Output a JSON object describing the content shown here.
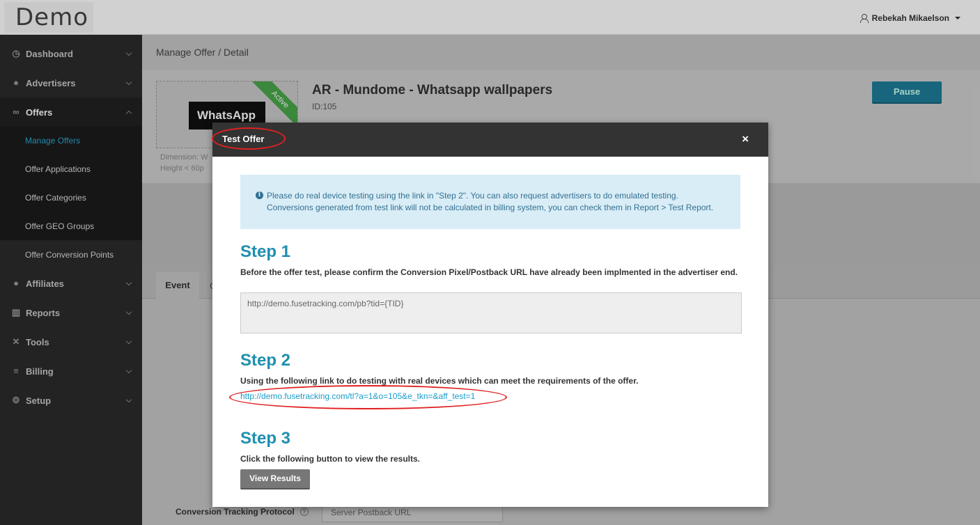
{
  "app": {
    "logo": "Demo",
    "user_name": "Rebekah Mikaelson"
  },
  "sidebar": {
    "items": [
      {
        "label": "Dashboard",
        "icon": "dashboard-icon"
      },
      {
        "label": "Advertisers",
        "icon": "user-icon"
      },
      {
        "label": "Offers",
        "icon": "link-icon"
      },
      {
        "label": "Affiliates",
        "icon": "users-icon"
      },
      {
        "label": "Reports",
        "icon": "bar-chart-icon"
      },
      {
        "label": "Tools",
        "icon": "tools-icon"
      },
      {
        "label": "Billing",
        "icon": "coins-icon"
      },
      {
        "label": "Setup",
        "icon": "gear-icon"
      }
    ],
    "offers_submenu": [
      "Manage Offers",
      "Offer Applications",
      "Offer Categories",
      "Offer GEO Groups",
      "Offer Conversion Points"
    ]
  },
  "main": {
    "breadcrumb": "Manage Offer / Detail",
    "offer_title": "AR - Mundome - Whatsapp wallpapers",
    "offer_id": "ID:105",
    "status_ribbon": "Active",
    "thumb_text": "WhatsApp",
    "thumb_note_1": "Dimension: W",
    "thumb_note_2": "Height < 60p",
    "pause_label": "Pause",
    "tab_event": "Event",
    "tab_other": "C",
    "conversion_label": "Conversion Tracking Protocol",
    "conversion_value": "Server Postback URL"
  },
  "modal": {
    "title": "Test Offer",
    "close": "×",
    "alert_line1": "Please do real device testing using the link in \"Step 2\". You can also request advertisers to do emulated testing.",
    "alert_line2": "Conversions generated from test link will not be calculated in billing system, you can check them in Report > Test Report.",
    "step1_title": "Step 1",
    "step1_desc": "Before the offer test, please confirm the Conversion Pixel/Postback URL have already been implmented in the advertiser end.",
    "pixel_url": "http://demo.fusetracking.com/pb?tid={TID}",
    "step2_title": "Step 2",
    "step2_desc": "Using the following link to do testing with real devices which can meet the requirements of the offer.",
    "test_link": "http://demo.fusetracking.com/tl?a=1&o=105&e_tkn=&aff_test=1",
    "step3_title": "Step 3",
    "step3_desc": "Click the following button to view the results.",
    "view_results_label": "View Results"
  },
  "colors": {
    "accent": "#1f8fb0",
    "annotation": "#e02020",
    "link": "#1a9cc9"
  }
}
